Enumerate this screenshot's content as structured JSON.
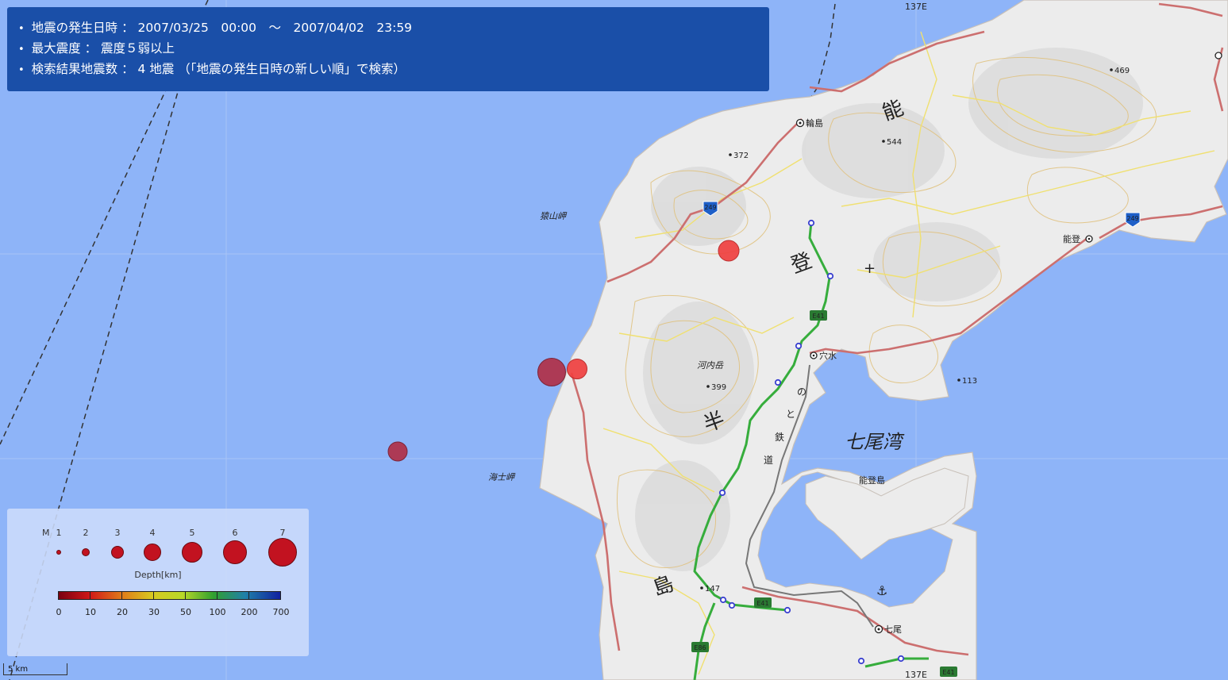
{
  "info_panel": {
    "line1": "地震の発生日時 ： 2007/03/25　00:00　～　2007/04/02　23:59",
    "line2": "最大震度 ： 震度５弱以上",
    "line3": "検索結果地震数 ： 4 地震 （「地震の発生日時の新しい順」で検索）"
  },
  "map_labels": {
    "meridian_top": "137E",
    "meridian_bottom": "137E",
    "wajima": "輪島",
    "noto_city": "能登",
    "anamizu": "穴水",
    "nanao": "七尾",
    "nanao_bay": "七尾湾",
    "notojima": "能登島",
    "sarayama": "猿山岬",
    "amamisaki": "海士岬",
    "kouchidake": "河内岳",
    "kanji_no": "能",
    "kanji_to": "登",
    "kanji_han": "半",
    "kanji_shima": "島",
    "railway1": "の",
    "railway2": "と",
    "railway3": "鉄",
    "railway4": "道",
    "elev_372": "372",
    "elev_544": "544",
    "elev_469": "469",
    "elev_399": "399",
    "elev_113": "113",
    "elev_147": "147",
    "route_249a": "249",
    "route_249b": "249",
    "route_e41a": "E41",
    "route_e41b": "E41",
    "route_e41c": "E41",
    "route_e86": "E86"
  },
  "earthquakes": [
    {
      "magnitude": 6.9,
      "depth_km": 11,
      "color": "#b03048"
    },
    {
      "magnitude": 5.3,
      "depth_km": 6,
      "color": "#f04040"
    },
    {
      "magnitude": 5.3,
      "depth_km": 12,
      "color": "#f04040"
    },
    {
      "magnitude": 4.8,
      "depth_km": 12,
      "color": "#b03048"
    }
  ],
  "legend": {
    "magnitude_label": "M",
    "magnitudes": [
      "1",
      "2",
      "3",
      "4",
      "5",
      "6",
      "7"
    ],
    "depth_title": "Depth[km]",
    "depth_ticks": [
      "0",
      "10",
      "20",
      "30",
      "50",
      "100",
      "200",
      "700"
    ],
    "dot_color": "#c21220"
  },
  "scale_bar": {
    "label": "5 km"
  },
  "colors": {
    "sea": "#8eb4f8",
    "land": "#eeeeee",
    "info_panel": "#1a4fa8"
  }
}
